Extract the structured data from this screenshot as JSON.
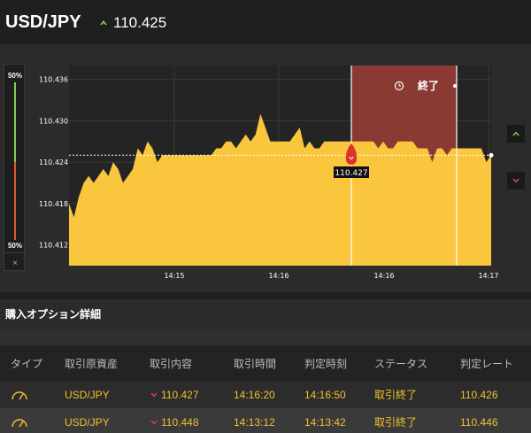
{
  "header": {
    "pair": "USD/JPY",
    "price": "110.425",
    "arrow_icon": "up-arrow-icon",
    "arrow_color": "#7fcf4c"
  },
  "side_panel": {
    "top_pct": "50%",
    "bottom_pct": "50%",
    "close_label": "×",
    "up_color": "#7fcf4c",
    "down_color": "#e05a3a"
  },
  "chart": {
    "y_ticks": [
      "110.436",
      "110.430",
      "110.424",
      "110.418",
      "110.412"
    ],
    "x_ticks": [
      "14:15",
      "14:16",
      "14:16",
      "14:17"
    ],
    "expiry_label": "終了",
    "marker_label": "110.427",
    "fill_color": "#f9c63d",
    "expiry_band_color": "#8b3a33"
  },
  "chart_data": {
    "type": "area",
    "ylim": [
      110.409,
      110.438
    ],
    "current_value": 110.425,
    "entry_value": 110.427,
    "x_tick_labels": [
      "14:15",
      "14:16",
      "14:16",
      "14:17"
    ],
    "values": [
      110.418,
      110.416,
      110.419,
      110.421,
      110.422,
      110.421,
      110.422,
      110.423,
      110.422,
      110.424,
      110.423,
      110.421,
      110.422,
      110.423,
      110.426,
      110.425,
      110.427,
      110.426,
      110.424,
      110.425,
      110.425,
      110.425,
      110.425,
      110.425,
      110.425,
      110.425,
      110.425,
      110.425,
      110.425,
      110.425,
      110.426,
      110.426,
      110.427,
      110.427,
      110.426,
      110.427,
      110.428,
      110.427,
      110.428,
      110.431,
      110.429,
      110.427,
      110.427,
      110.427,
      110.427,
      110.427,
      110.428,
      110.429,
      110.426,
      110.427,
      110.426,
      110.426,
      110.427,
      110.427,
      110.427,
      110.427,
      110.427,
      110.427,
      110.427,
      110.427,
      110.427,
      110.427,
      110.427,
      110.426,
      110.427,
      110.426,
      110.426,
      110.427,
      110.427,
      110.427,
      110.427,
      110.426,
      110.426,
      110.426,
      110.424,
      110.426,
      110.426,
      110.425,
      110.426,
      110.426,
      110.426,
      110.426,
      110.426,
      110.426,
      110.426,
      110.424,
      110.425
    ]
  },
  "right_buttons": {
    "up_icon": "up-arrow-icon",
    "down_icon": "down-arrow-icon"
  },
  "section": {
    "title": "購入オプション詳細"
  },
  "table": {
    "headers": [
      "タイプ",
      "取引原資産",
      "取引内容",
      "取引時間",
      "判定時刻",
      "ステータス",
      "判定レート"
    ],
    "rows": [
      {
        "type_icon": "gauge-icon",
        "asset": "USD/JPY",
        "direction_icon": "down-arrow-icon",
        "rate": "110.427",
        "trade_time": "14:16:20",
        "judge_time": "14:16:50",
        "status": "取引終了",
        "judge_rate": "110.426"
      },
      {
        "type_icon": "gauge-icon",
        "asset": "USD/JPY",
        "direction_icon": "down-arrow-icon",
        "rate": "110.448",
        "trade_time": "14:13:12",
        "judge_time": "14:13:42",
        "status": "取引終了",
        "judge_rate": "110.446"
      }
    ]
  }
}
